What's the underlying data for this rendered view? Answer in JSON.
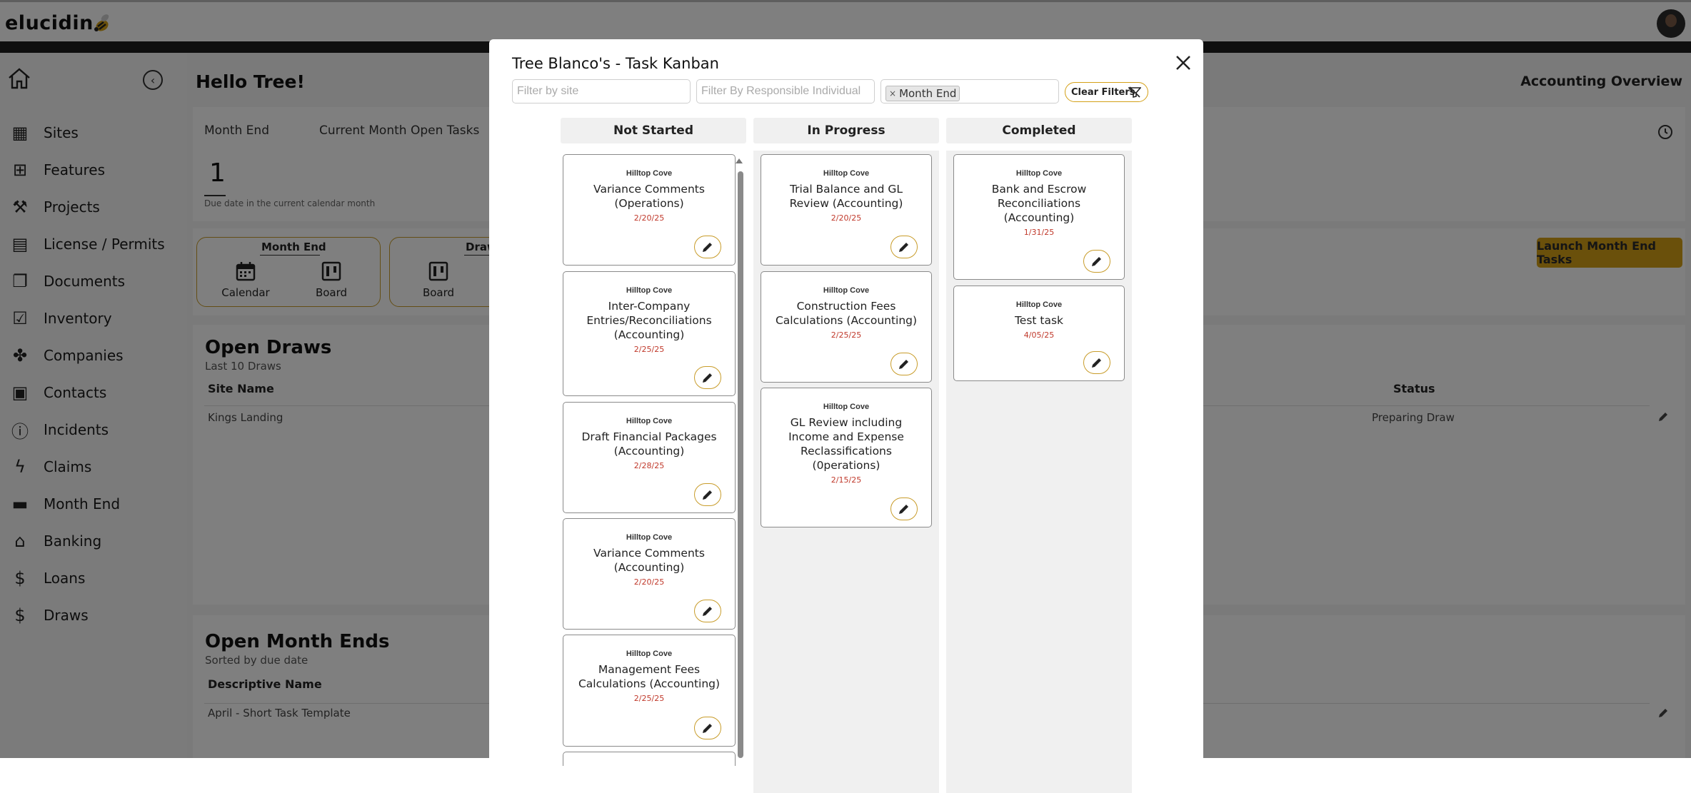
{
  "app": {
    "logo": "elucidin"
  },
  "sidebar": {
    "items": [
      {
        "label": "Sites",
        "icon": "sites-icon"
      },
      {
        "label": "Features",
        "icon": "features-icon"
      },
      {
        "label": "Projects",
        "icon": "projects-icon"
      },
      {
        "label": "License / Permits",
        "icon": "license-icon"
      },
      {
        "label": "Documents",
        "icon": "documents-icon"
      },
      {
        "label": "Inventory",
        "icon": "inventory-icon"
      },
      {
        "label": "Companies",
        "icon": "companies-icon"
      },
      {
        "label": "Contacts",
        "icon": "contacts-icon"
      },
      {
        "label": "Incidents",
        "icon": "incidents-icon"
      },
      {
        "label": "Claims",
        "icon": "claims-icon"
      },
      {
        "label": "Month End",
        "icon": "month-end-icon"
      },
      {
        "label": "Banking",
        "icon": "banking-icon"
      },
      {
        "label": "Loans",
        "icon": "loans-icon"
      },
      {
        "label": "Draws",
        "icon": "draws-icon"
      }
    ]
  },
  "main": {
    "greeting": "Hello Tree!",
    "view_title": "Accounting Overview",
    "tabs": [
      "Month End",
      "Current Month Open Tasks"
    ],
    "count": "1",
    "count_caption": "Due date in the current calendar month",
    "month_end_group": {
      "title": "Month End",
      "calendar": "Calendar",
      "board": "Board"
    },
    "draw_group": {
      "title": "Draw",
      "board": "Board"
    },
    "launch_button": "Launch Month End Tasks",
    "open_draws": {
      "title": "Open Draws",
      "subtitle": "Last 10 Draws",
      "col_site": "Site Name",
      "col_status": "Status",
      "rows": [
        {
          "site": "Kings Landing",
          "status": "Preparing Draw"
        }
      ]
    },
    "open_month_ends": {
      "title": "Open Month Ends",
      "subtitle": "Sorted by due date",
      "col_name": "Descriptive Name",
      "rows": [
        {
          "name": "April - Short Task Template"
        }
      ]
    }
  },
  "modal": {
    "title": "Tree Blanco's - Task Kanban",
    "filter_site_placeholder": "Filter by site",
    "filter_person_placeholder": "Filter By Responsible Individual",
    "chip_label": "Month End",
    "clear_filters": "Clear Filters",
    "columns": {
      "not_started": {
        "title": "Not Started",
        "cards": [
          {
            "site": "Hilltop Cove",
            "name": "Variance Comments (Operations)",
            "date": "2/20/25"
          },
          {
            "site": "Hilltop Cove",
            "name": "Inter-Company Entries/Reconciliations (Accounting)",
            "date": "2/25/25"
          },
          {
            "site": "Hilltop Cove",
            "name": "Draft Financial Packages (Accounting)",
            "date": "2/28/25"
          },
          {
            "site": "Hilltop Cove",
            "name": "Variance Comments (Accounting)",
            "date": "2/20/25"
          },
          {
            "site": "Hilltop Cove",
            "name": "Management Fees Calculations (Accounting)",
            "date": "2/25/25"
          }
        ]
      },
      "in_progress": {
        "title": "In Progress",
        "cards": [
          {
            "site": "Hilltop Cove",
            "name": "Trial Balance and GL Review (Accounting)",
            "date": "2/20/25"
          },
          {
            "site": "Hilltop Cove",
            "name": "Construction Fees Calculations (Accounting)",
            "date": "2/25/25"
          },
          {
            "site": "Hilltop Cove",
            "name": "GL Review including Income and Expense Reclassifications (0perations)",
            "date": "2/15/25"
          }
        ]
      },
      "completed": {
        "title": "Completed",
        "cards": [
          {
            "site": "Hilltop Cove",
            "name": "Bank and Escrow Reconciliations (Accounting)",
            "date": "1/31/25"
          },
          {
            "site": "Hilltop Cove",
            "name": "Test task",
            "date": "4/05/25"
          }
        ]
      }
    }
  },
  "colors": {
    "accent": "#d4a017",
    "date_red": "#c0392b"
  }
}
